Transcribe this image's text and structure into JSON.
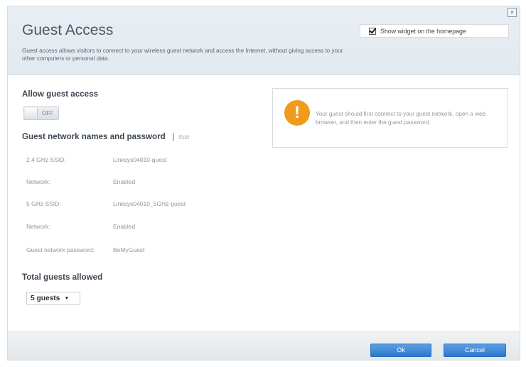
{
  "header": {
    "title": "Guest Access",
    "description": "Guest access allows visitors to connect to your wireless guest network and access the Internet, without giving access to your other computers or personal data.",
    "widget_checkbox": {
      "label": "Show widget on the homepage",
      "checked": true
    },
    "close_icon": "close-icon"
  },
  "allow_guest": {
    "title": "Allow guest access",
    "toggle": {
      "label": "OFF",
      "state": "off"
    }
  },
  "guest_network": {
    "title": "Guest network names and password",
    "separator": "|",
    "edit_label": "Edit",
    "rows": [
      {
        "label": "2.4 GHz SSID:",
        "value": "Linksys04010-guest"
      },
      {
        "label": "Network:",
        "value": "Enabled"
      },
      {
        "label": "5 GHz SSID:",
        "value": "Linksys04010_5GHz-guest"
      },
      {
        "label": "Network:",
        "value": "Enabled"
      },
      {
        "label": "Guest network password:",
        "value": "BeMyGuest"
      }
    ]
  },
  "info": {
    "icon": "warning-icon",
    "icon_glyph": "!",
    "text": "Your guest should first connect to your guest network, open a web browser, and then enter the guest password."
  },
  "total_guests": {
    "title": "Total guests allowed",
    "selected": "5 guests"
  },
  "footer": {
    "ok_label": "Ok",
    "cancel_label": "Cancel"
  },
  "colors": {
    "accent": "#2d78cc",
    "warning": "#f29a1b",
    "header_bg": "#e5ebf0"
  }
}
